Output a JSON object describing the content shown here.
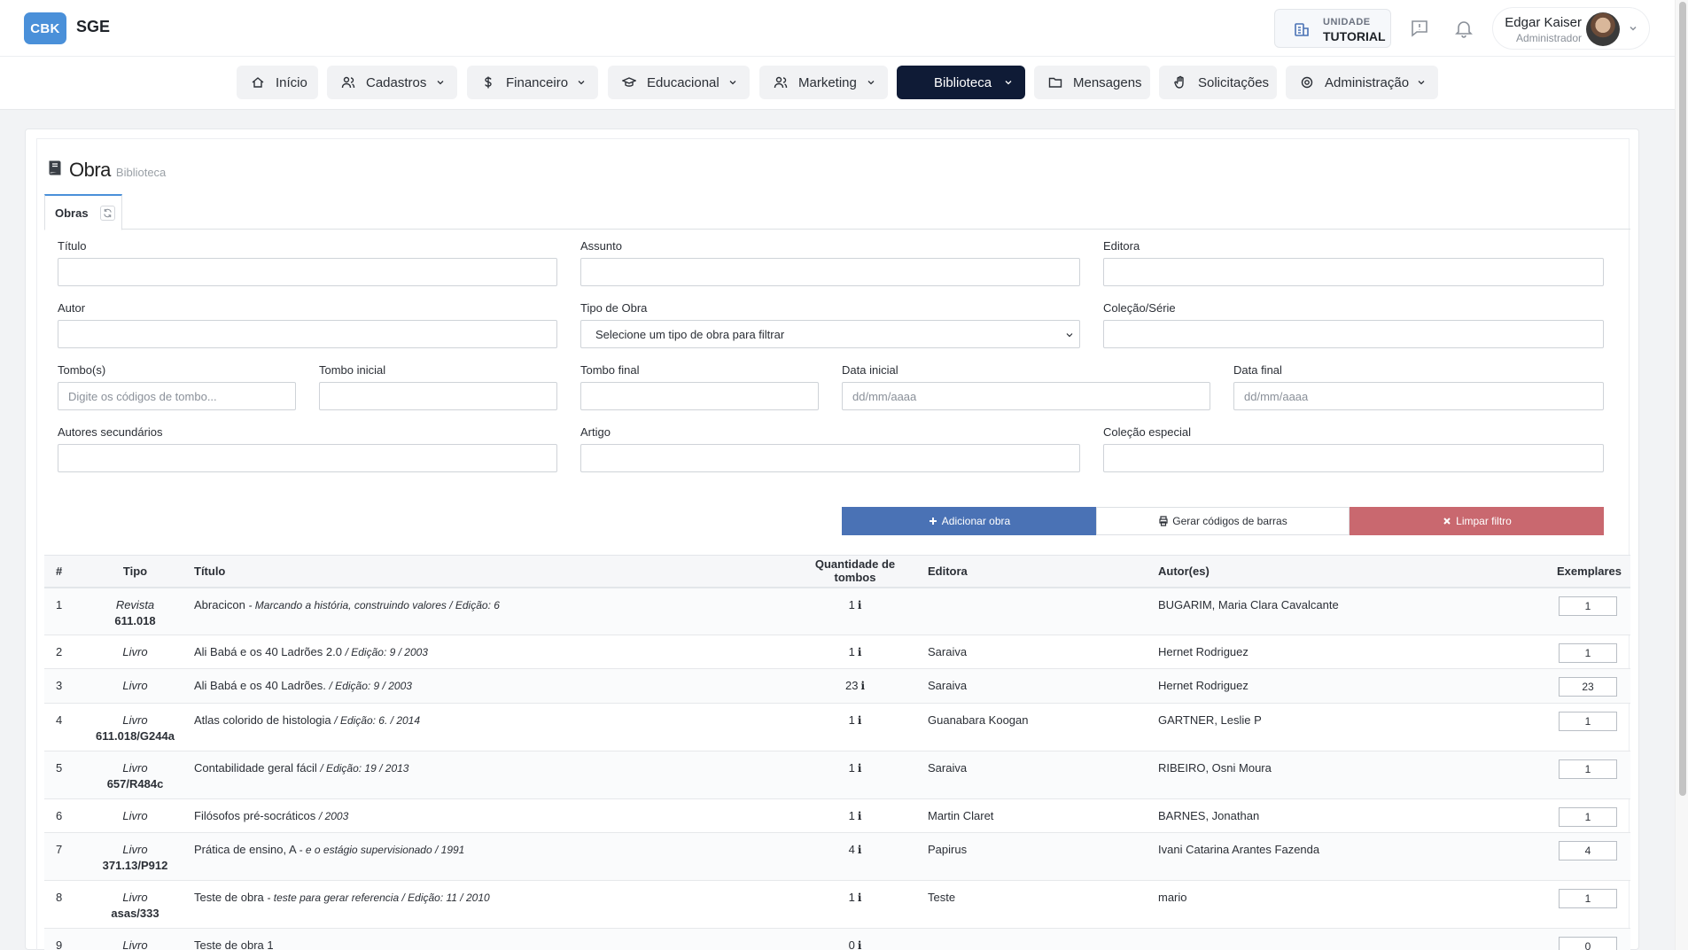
{
  "header": {
    "logo": "CBK",
    "app_name": "SGE",
    "unit_label": "UNIDADE",
    "unit_name": "TUTORIAL",
    "user_name": "Edgar Kaiser",
    "user_role": "Administrador"
  },
  "nav": [
    {
      "label": "Início",
      "icon": "home-icon"
    },
    {
      "label": "Cadastros",
      "icon": "users-icon"
    },
    {
      "label": "Financeiro",
      "icon": "dollar-icon"
    },
    {
      "label": "Educacional",
      "icon": "graduation-cap-icon"
    },
    {
      "label": "Marketing",
      "icon": "users-icon"
    },
    {
      "label": "Biblioteca",
      "icon": "book-icon",
      "active": true
    },
    {
      "label": "Mensagens",
      "icon": "folder-icon"
    },
    {
      "label": "Solicitações",
      "icon": "hand-icon"
    },
    {
      "label": "Administração",
      "icon": "gear-icon"
    }
  ],
  "page": {
    "title": "Obra",
    "subtitle": "Biblioteca",
    "tab": "Obras"
  },
  "filters": {
    "titulo": "Título",
    "assunto": "Assunto",
    "editora": "Editora",
    "autor": "Autor",
    "tipo_obra": "Tipo de Obra",
    "tipo_obra_value": "Selecione um tipo de obra para filtrar",
    "colecao_serie": "Coleção/Série",
    "tombos": "Tombo(s)",
    "tombos_placeholder": "Digite os códigos de tombo...",
    "tombo_inicial": "Tombo inicial",
    "tombo_final": "Tombo final",
    "data_inicial": "Data inicial",
    "data_final": "Data final",
    "date_placeholder": "dd/mm/aaaa",
    "autores_secundarios": "Autores secundários",
    "artigo": "Artigo",
    "colecao_especial": "Coleção especial"
  },
  "actions": {
    "add": "Adicionar obra",
    "barcodes": "Gerar códigos de barras",
    "clear": "Limpar filtro"
  },
  "colors": {
    "primary": "#4a72b5",
    "danger": "#c9686f",
    "nav_active": "#0f1b36",
    "logo": "#4a90d9"
  },
  "table": {
    "headers": [
      "#",
      "Tipo",
      "Título",
      "Quantidade de tombos",
      "Editora",
      "Autor(es)",
      "Exemplares"
    ],
    "rows": [
      {
        "num": "1",
        "tipo": "Revista",
        "code": "611.018",
        "titulo": "Abracicon",
        "extra": " - Marcando a história, construindo valores / Edição: 6",
        "qtd": "1",
        "editora": "",
        "autor": "BUGARIM, Maria Clara Cavalcante",
        "exemplares": "1"
      },
      {
        "num": "2",
        "tipo": "Livro",
        "code": "",
        "titulo": "Ali Babá e os 40 Ladrões 2.0",
        "extra": "/ Edição: 9 / 2003",
        "qtd": "1",
        "editora": "Saraiva",
        "autor": "Hernet Rodriguez",
        "exemplares": "1"
      },
      {
        "num": "3",
        "tipo": "Livro",
        "code": "",
        "titulo": "Ali Babá e os 40 Ladrões.",
        "extra": "/ Edição: 9 / 2003",
        "qtd": "23",
        "editora": "Saraiva",
        "autor": "Hernet Rodriguez",
        "exemplares": "23"
      },
      {
        "num": "4",
        "tipo": "Livro",
        "code": "611.018/G244a",
        "titulo": "Atlas colorido de histologia",
        "extra": "/ Edição: 6. / 2014",
        "qtd": "1",
        "editora": "Guanabara Koogan",
        "autor": "GARTNER, Leslie P",
        "exemplares": "1"
      },
      {
        "num": "5",
        "tipo": "Livro",
        "code": "657/R484c",
        "titulo": "Contabilidade geral fácil",
        "extra": "/ Edição: 19 / 2013",
        "qtd": "1",
        "editora": "Saraiva",
        "autor": "RIBEIRO, Osni Moura",
        "exemplares": "1"
      },
      {
        "num": "6",
        "tipo": "Livro",
        "code": "",
        "titulo": "Filósofos pré-socráticos",
        "extra": "/ 2003",
        "qtd": "1",
        "editora": "Martin Claret",
        "autor": "BARNES, Jonathan",
        "exemplares": "1"
      },
      {
        "num": "7",
        "tipo": "Livro",
        "code": "371.13/P912",
        "titulo": "Prática de ensino, A",
        "extra": " - e o estágio supervisionado / 1991",
        "qtd": "4",
        "editora": "Papirus",
        "autor": "Ivani Catarina Arantes Fazenda",
        "exemplares": "4"
      },
      {
        "num": "8",
        "tipo": "Livro",
        "code": "asas/333",
        "titulo": "Teste de obra",
        "extra": " - teste para gerar referencia / Edição: 11 / 2010",
        "qtd": "1",
        "editora": "Teste",
        "autor": "mario",
        "exemplares": "1"
      },
      {
        "num": "9",
        "tipo": "Livro",
        "code": "",
        "titulo": "Teste de obra 1",
        "extra": "",
        "qtd": "0",
        "editora": "",
        "autor": "",
        "exemplares": "0"
      }
    ]
  }
}
